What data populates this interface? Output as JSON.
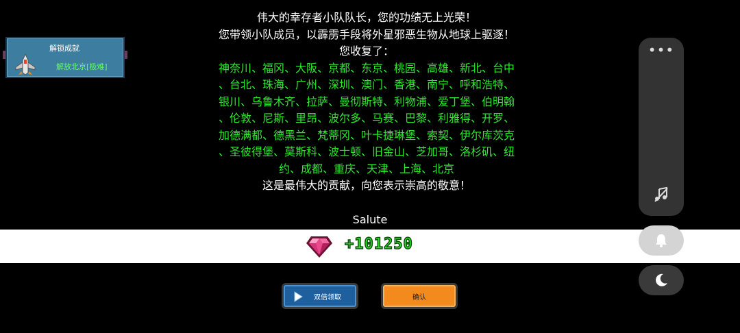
{
  "message": {
    "line1": "伟大的幸存者小队队长，您的功绩无上光荣！",
    "line2": "您带领小队成员，以霹雳手段将外星邪恶生物从地球上驱逐！",
    "line3": "您收复了：",
    "cities": [
      "神奈川、福冈、大阪、京都、东京、桃园、高雄、新北、台中",
      "、台北、珠海、广州、深圳、澳门、香港、南宁、呼和浩特、",
      "银川、乌鲁木齐、拉萨、曼彻斯特、利物浦、爱丁堡、伯明翰",
      "、伦敦、尼斯、里昂、波尔多、马赛、巴黎、利雅得、开罗、",
      "加德满都、德黑兰、梵蒂冈、叶卡捷琳堡、索契、伊尔库茨克",
      "、圣彼得堡、莫斯科、波士顿、旧金山、芝加哥、洛杉矶、纽",
      "约、成都、重庆、天津、上海、北京"
    ],
    "closing": "这是最伟大的贡献，向您表示崇高的敬意！"
  },
  "salute_label": "Salute",
  "reward": {
    "icon": "pink-gem-icon",
    "amount": "+101250"
  },
  "achievement": {
    "title": "解锁成就",
    "name": "解放北京[极难]",
    "icon": "fighter-jet-badge-icon"
  },
  "buttons": {
    "double_label": "双倍领取",
    "confirm_label": "确认"
  },
  "side_panel": {
    "more_icon": "more-dots-icon",
    "music_icon": "music-off-icon",
    "bell_icon": "bell-icon",
    "moon_icon": "moon-icon"
  },
  "colors": {
    "city_text": "#2ee82e",
    "reward_text": "#33e62b",
    "blue_button": "#1e5f9e",
    "orange_button": "#f28a1e"
  }
}
